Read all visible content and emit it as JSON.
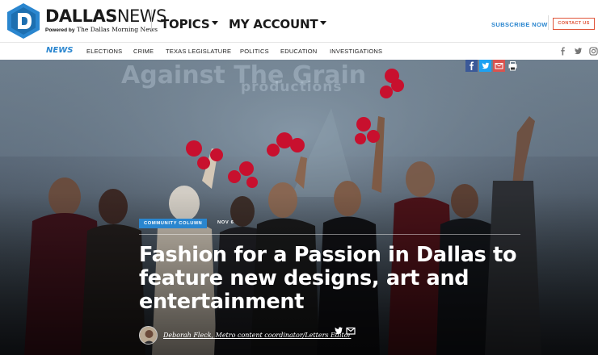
{
  "header": {
    "brand_bold": "DALLAS",
    "brand_light": "NEWS",
    "powered_by": "Powered by",
    "powered_pub": "The Dallas Morning News",
    "topics": "TOPICS",
    "my_account": "MY ACCOUNT",
    "subscribe": "SUBSCRIBE NOW",
    "contact": "CONTACT US"
  },
  "section_nav": {
    "active": "NEWS",
    "items": [
      "ELECTIONS",
      "CRIME",
      "TEXAS LEGISLATURE",
      "POLITICS",
      "EDUCATION",
      "INVESTIGATIONS"
    ],
    "social": [
      "facebook-icon",
      "twitter-icon",
      "instagram-icon"
    ]
  },
  "hero": {
    "banner_text": "Against The Grain",
    "banner_sub": "productions",
    "kicker": "COMMUNITY COLUMN",
    "date": "NOV 6",
    "headline": "Fashion for a Passion in Dallas to feature new designs, art and entertainment",
    "author": "Deborah Fleck, Metro content coordinator/Letters Editor",
    "share_icons": [
      "facebook-icon",
      "twitter-icon",
      "email-icon",
      "print-icon"
    ],
    "colors": {
      "accent": "#2a86cf",
      "facebook": "#3b5998",
      "twitter": "#1da1f2",
      "email": "#d9534f",
      "contact": "#e0563b"
    }
  }
}
